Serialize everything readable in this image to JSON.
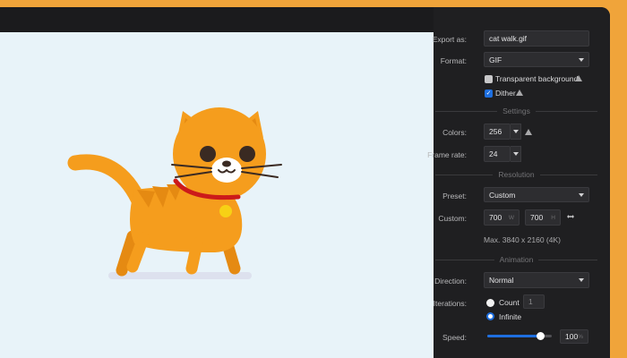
{
  "panel": {
    "export_as": {
      "label": "Export as:",
      "value": "cat walk.gif"
    },
    "format": {
      "label": "Format:",
      "value": "GIF"
    },
    "transparent_background": {
      "label": "Transparent background",
      "checked": false
    },
    "dither": {
      "label": "Dither",
      "checked": true
    },
    "settings": {
      "title": "Settings",
      "colors": {
        "label": "Colors:",
        "value": "256"
      },
      "frame_rate": {
        "label": "Frame rate:",
        "value": "24"
      }
    },
    "resolution": {
      "title": "Resolution",
      "preset": {
        "label": "Preset:",
        "value": "Custom"
      },
      "custom": {
        "label": "Custom:",
        "width": "700",
        "width_unit": "W",
        "height": "700",
        "height_unit": "H"
      },
      "max_note": "Max. 3840 x 2160 (4K)"
    },
    "animation": {
      "title": "Animation",
      "direction": {
        "label": "Direction:",
        "value": "Normal"
      },
      "iterations": {
        "label": "Iterations:",
        "count_label": "Count",
        "count_value": "1",
        "infinite_label": "Infinite",
        "selected": "Infinite"
      },
      "speed": {
        "label": "Speed:",
        "value": "100",
        "unit": "%",
        "level": 0.83
      }
    }
  },
  "icons": {
    "warning": "warning-triangle-icon",
    "link": "link-dimensions-icon"
  },
  "colors": {
    "background": "#f0a43a",
    "canvas": "#e8f3f9",
    "panel": "#1f1f21",
    "accent": "#1e6fe0",
    "cat_body": "#f59d1d",
    "collar": "#cc1a1a",
    "bell": "#f7d115"
  }
}
